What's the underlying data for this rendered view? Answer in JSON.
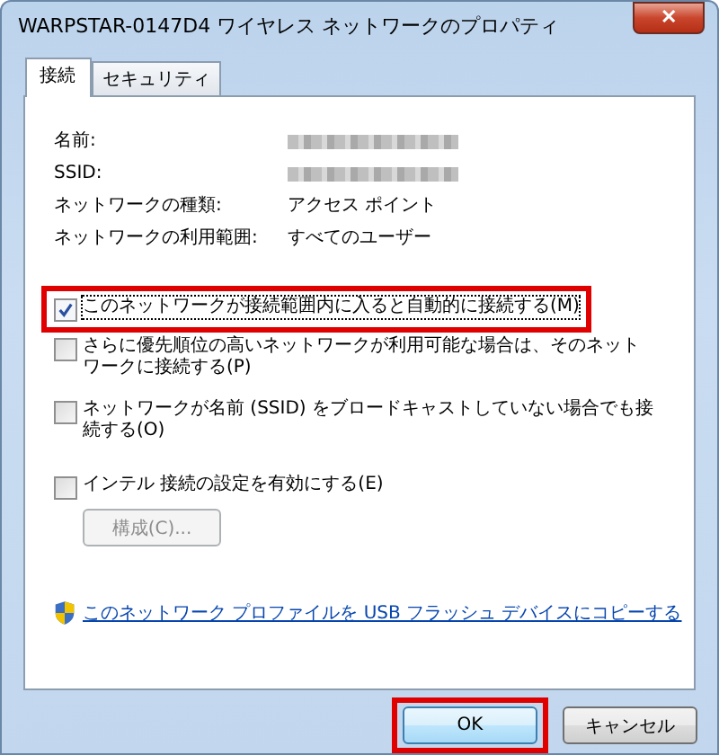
{
  "window": {
    "title": "WARPSTAR-0147D4 ワイヤレス ネットワークのプロパティ",
    "close": "✕"
  },
  "tabs": [
    {
      "label": "接続",
      "selected": true
    },
    {
      "label": "セキュリティ",
      "selected": false
    }
  ],
  "properties": [
    {
      "label": "名前:",
      "value_redacted": true
    },
    {
      "label": "SSID:",
      "value_redacted": true
    },
    {
      "label": "ネットワークの種類:",
      "value": "アクセス ポイント"
    },
    {
      "label": "ネットワークの利用範囲:",
      "value": "すべてのユーザー"
    }
  ],
  "options": [
    {
      "kind": "checkbox",
      "label": "このネットワークが接続範囲内に入ると自動的に接続する(M)",
      "checked": true,
      "highlighted": true
    },
    {
      "kind": "checkbox",
      "label": "さらに優先順位の高いネットワークが利用可能な場合は、そのネットワークに接続する(P)",
      "checked": false,
      "highlighted": false
    },
    {
      "kind": "checkbox",
      "label": "ネットワークが名前 (SSID) をブロードキャストしていない場合でも接続する(O)",
      "checked": false,
      "highlighted": false
    },
    {
      "kind": "checkbox",
      "label": "インテル 接続の設定を有効にする(E)",
      "checked": false,
      "highlighted": false
    },
    {
      "kind": "button",
      "label": "構成(C)...",
      "disabled": true
    }
  ],
  "link": "このネットワーク プロファイルを USB フラッシュ デバイスにコピーする",
  "buttons": [
    {
      "label": "OK",
      "highlighted": true
    },
    {
      "label": "キャンセル",
      "highlighted": false
    }
  ]
}
